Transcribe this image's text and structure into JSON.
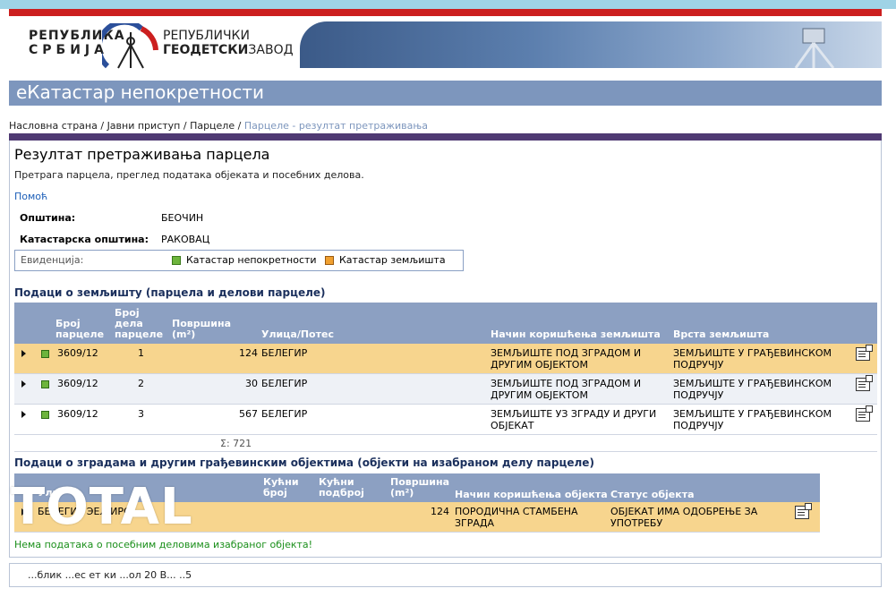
{
  "header": {
    "logo_left_line1": "РЕПУБЛИКА",
    "logo_left_line2": "СРБИЈА",
    "logo_right_line1": "РЕПУБЛИЧКИ",
    "logo_right_line2a": "ГЕОДЕТСКИ",
    "logo_right_line2b": "ЗАВОД",
    "app_title": "еКатастар непокретности"
  },
  "breadcrumb": {
    "home": "Насловна страна",
    "sep": " / ",
    "public": "Јавни приступ",
    "parcels": "Парцеле",
    "current": "Парцеле - резултат претраживања"
  },
  "page": {
    "title": "Резултат претраживања парцела",
    "subtitle": "Претрага парцела, преглед података објеката и посебних делова.",
    "help": "Помоћ",
    "municipality_label": "Општина:",
    "municipality_value": "БЕОЧИН",
    "cadastral_label": "Катастарска општина:",
    "cadastral_value": "РАКОВАЦ",
    "evidence_label": "Евиденција:",
    "legend_1": "Катастар непокретности",
    "legend_2": "Катастар земљишта"
  },
  "land": {
    "heading": "Подаци о земљишту (парцела и делови парцеле)",
    "columns": {
      "parcel_no_1": "Број",
      "parcel_no_2": "парцеле",
      "part_no_1": "Број",
      "part_no_2": "дела",
      "part_no_3": "парцеле",
      "area_1": "Површина",
      "area_2": "(m²)",
      "street": "Улица/Потес",
      "usage": "Начин коришћења земљишта",
      "type": "Врста земљишта"
    },
    "rows": [
      {
        "parcel": "3609/12",
        "part": "1",
        "area": "124",
        "street": "БЕЛЕГИР",
        "usage_1": "ЗЕМЉИШТЕ ПОД ЗГРАДОМ И",
        "usage_2": "ДРУГИМ ОБЈЕКТОМ",
        "type_1": "ЗЕМЉИШТЕ У ГРАЂЕВИНСКОМ",
        "type_2": "ПОДРУЧЈУ"
      },
      {
        "parcel": "3609/12",
        "part": "2",
        "area": "30",
        "street": "БЕЛЕГИР",
        "usage_1": "ЗЕМЉИШТЕ ПОД ЗГРАДОМ И",
        "usage_2": "ДРУГИМ ОБЈЕКТОМ",
        "type_1": "ЗЕМЉИШТЕ У ГРАЂЕВИНСКОМ",
        "type_2": "ПОДРУЧЈУ"
      },
      {
        "parcel": "3609/12",
        "part": "3",
        "area": "567",
        "street": "БЕЛЕГИР",
        "usage_1": "ЗЕМЉИШТЕ УЗ ЗГРАДУ И ДРУГИ",
        "usage_2": "ОБЈЕКАТ",
        "type_1": "ЗЕМЉИШТЕ У ГРАЂЕВИНСКОМ",
        "type_2": "ПОДРУЧЈУ"
      }
    ],
    "sum": "Σ: 721"
  },
  "buildings": {
    "heading": "Подаци о зградама и другим грађевинским објектима (објекти на изабраном делу парцеле)",
    "columns": {
      "street_part": "Ули",
      "house_no_1": "Кућни",
      "house_no_2": "број",
      "house_sub_1": "Кућни",
      "house_sub_2": "подброј",
      "area_1": "Површина",
      "area_2": "(m²)",
      "usage": "Начин коришћења објекта",
      "status": "Статус објекта"
    },
    "row": {
      "street_fragment": "БЕЛЕГИР  ЭЕЛ  ИРС  ,",
      "area": "124",
      "usage_1": "ПОРОДИЧНА СТАМБЕНА",
      "usage_2": "ЗГРАДА",
      "status_1": "ОБЈЕКАТ ИМА ОДОБРЕЊЕ ЗА",
      "status_2": "УПОТРЕБУ"
    },
    "notice": "Нема података о посебним деловима изабраног објекта!"
  },
  "footer": {
    "text": "...блик  ...ес  ет  ки  ...ол  20  В... ..5"
  },
  "overlay": {
    "text": "TOTAL"
  },
  "colors": {
    "title_bar": "#7d96bd",
    "table_header": "#8ca0c2",
    "selected_row": "#f7d58e",
    "red_strip": "#cc1f1f",
    "purple_strip": "#4f3a73"
  }
}
